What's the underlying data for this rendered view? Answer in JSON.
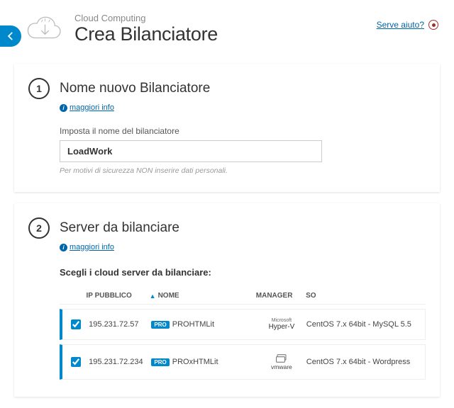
{
  "header": {
    "breadcrumb": "Cloud Computing",
    "title": "Crea Bilanciatore",
    "help_label": "Serve aiuto?"
  },
  "step1": {
    "number": "1",
    "title": "Nome nuovo Bilanciatore",
    "more_info": "maggiori info",
    "field_label": "Imposta il nome del bilanciatore",
    "value": "LoadWork",
    "hint": "Per motivi di sicurezza NON inserire dati personali."
  },
  "step2": {
    "number": "2",
    "title": "Server da bilanciare",
    "more_info": "maggiori info",
    "choose_label": "Scegli i cloud server da bilanciare:",
    "columns": {
      "ip": "IP PUBBLICO",
      "name": "NOME",
      "manager": "MANAGER",
      "so": "SO"
    },
    "servers": [
      {
        "checked": true,
        "ip": "195.231.72.57",
        "badge": "PRO",
        "name": "PROHTMLit",
        "manager": "Hyper-V",
        "so": "CentOS 7.x 64bit - MySQL 5.5"
      },
      {
        "checked": true,
        "ip": "195.231.72.234",
        "badge": "PRO",
        "name": "PROxHTMLit",
        "manager": "vmware",
        "so": "CentOS 7.x 64bit - Wordpress"
      }
    ]
  }
}
